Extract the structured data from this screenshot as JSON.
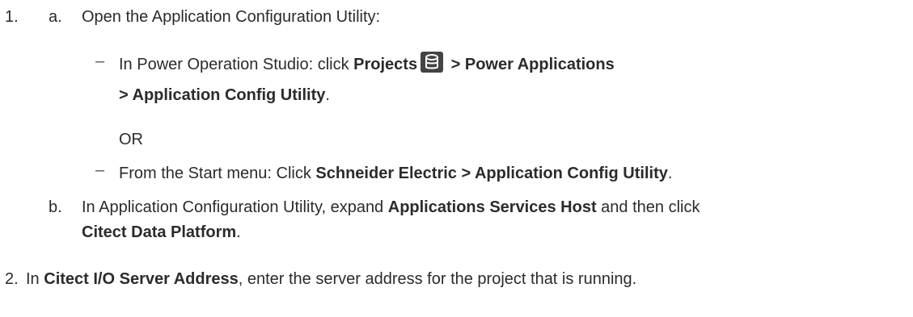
{
  "steps": {
    "step1": {
      "number": "1.",
      "a": {
        "letter": "a.",
        "text": "Open the Application Configuration Utility:",
        "option1": {
          "prefix": "In Power Operation Studio: click ",
          "projects": "Projects",
          "after_icon": " > Power Applications",
          "line2_bold": "> Application Config Utility",
          "line2_end": "."
        },
        "or": "OR",
        "option2": {
          "prefix": "From the Start menu: Click ",
          "bold": "Schneider Electric > Application Config Utility",
          "end": "."
        }
      },
      "b": {
        "letter": "b.",
        "prefix": "In Application Configuration Utility, expand ",
        "bold1": "Applications Services Host",
        "middle": " and then click",
        "bold2": "Citect Data Platform",
        "end": "."
      }
    },
    "step2": {
      "number": "2.",
      "prefix": "In ",
      "bold": "Citect I/O Server Address",
      "rest": ", enter the server address for the project that is running."
    }
  },
  "icons": {
    "projects_icon": "database-icon",
    "icon_color": "#444444"
  }
}
